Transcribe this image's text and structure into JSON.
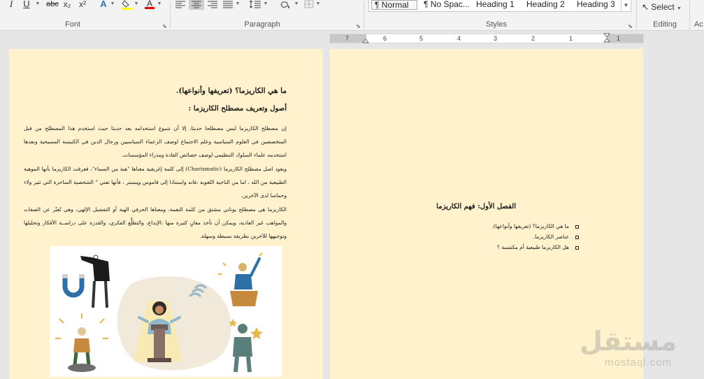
{
  "ribbon": {
    "font_buttons": [
      "I",
      "U",
      "abc",
      "x₂",
      "x²",
      "A",
      "A"
    ],
    "font_label": "Font",
    "paragraph_label": "Paragraph",
    "styles_label": "Styles",
    "editing_label": "Editing",
    "cut_off_label": "Ac",
    "select_label": "Select",
    "styles": [
      "¶ Normal",
      "¶ No Spac...",
      "Heading 1",
      "Heading 2",
      "Heading 3"
    ],
    "accent_highlight": "#ffff00",
    "accent_font_color": "#e00000"
  },
  "ruler": {
    "numbers": [
      "7",
      "6",
      "5",
      "4",
      "3",
      "2",
      "1",
      "1"
    ]
  },
  "left_page": {
    "title": "ما هي الكاريزما؟ (تعريفها وأنواعها).",
    "subtitle": "أصول وتعريف مصطلح الكاريزما :",
    "para1": "إن مصطلح الكاريزما ليس مصطلحا حديثا، إلا أن شيوع استخدامه يعد حديثا حيث استخدم هذا المصطلح من قبل المتخصصين في العلوم السياسية وعلم الاجتماع لوصف الزعماء السياسيين ورجال الدين في الكنيسة المسيحية وبعدها استخدمه علماء السلوك التنظيمي لوصف خصائص القادة ومدراء المؤسسات.",
    "para2": "ويعود اصل مصطلح الكاريزما (Charismatic) إلى كلمة إغريقية معناها \"هبة من السماء\"، فعرفت الكاريزما بأنها الموهبة الطبيعية من الله ، اما من الناحية اللغوية ،فانه واستنادا إلى قاموس ويبستر ، فأنها تعني \" الشخصية الساحرة التي تثير ولاء وحماسا لدى الآخرين.",
    "para3": "الكاريزما هي مصطلح يوناني مشتق من كلمة النعمة، ومعناها الحرفي الهبة أو التفضيل الإلهي، وهي تُعبّر عن الصفات والمواهب غير العادية، ويمكن أن تأخذ معانٍ كثيرة منها :الإبداع، والتطلُّع الفكري، والقدرة على دراســة الأفكار وتحليلها وتوجيهها للآخرين بطريقة بسيطة وسهلة."
  },
  "right_page": {
    "chapter_title": "الفصل الأول: فهم الكاريزما",
    "bullets": [
      "ما هي الكاريزما؟ (تعريفها وأنواعها).",
      "عناصر الكاريزما.",
      "هل الكاريزما طبيعية أم مكتسبة ؟"
    ]
  },
  "watermark": {
    "arabic": "مستقل",
    "latin": "mostaql.com"
  },
  "colors": {
    "page_background": "#fff2cc",
    "app_background": "#e6e6e6",
    "ribbon_background": "#f3f3f3"
  }
}
